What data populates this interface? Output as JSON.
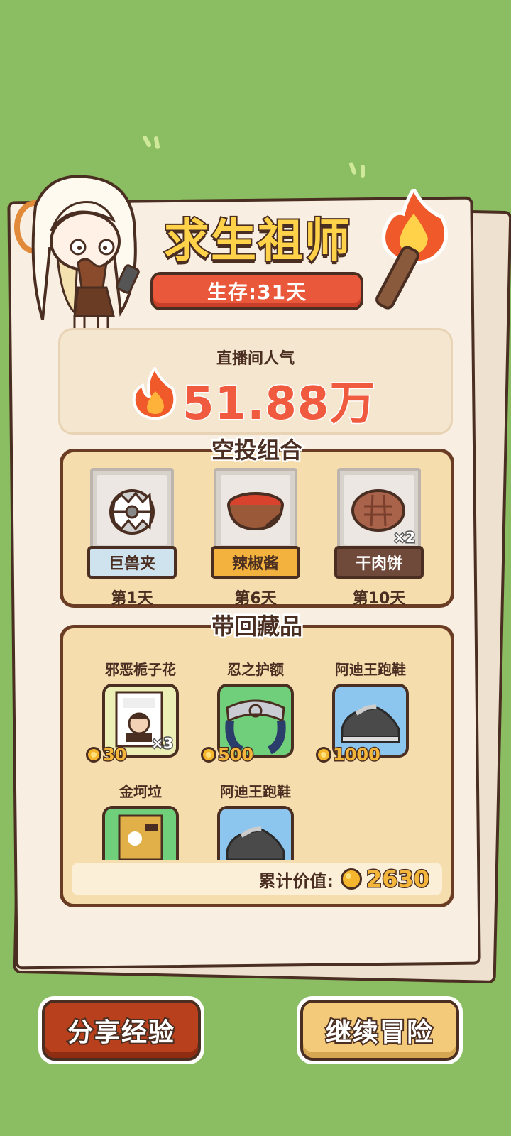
{
  "header": {
    "title": "求生祖师",
    "survival": "生存:31天"
  },
  "popularity": {
    "label": "直播间人气",
    "value": "51.88万"
  },
  "airdrop": {
    "title": "空投组合",
    "items": [
      {
        "name": "巨兽夹",
        "day": "第1天",
        "tag_color": "#cfe3ef",
        "text_color": "#4a2e21"
      },
      {
        "name": "辣椒酱",
        "day": "第6天",
        "tag_color": "#f2b23d",
        "text_color": "#4a2e21"
      },
      {
        "name": "干肉饼",
        "day": "第10天",
        "tag_color": "#6f4a3b",
        "text_color": "#ffffff",
        "qty": "×2"
      }
    ]
  },
  "collection": {
    "title": "带回藏品",
    "items": [
      {
        "name": "邪恶栀子花",
        "price": "30",
        "qty": "×3",
        "card_color": "#ecf0b6",
        "icon": "book-icon"
      },
      {
        "name": "忍之护额",
        "price": "500",
        "card_color": "#6fcf7a",
        "icon": "headband-icon"
      },
      {
        "name": "阿迪王跑鞋",
        "price": "1000",
        "card_color": "#8cc6ef",
        "icon": "sneaker-icon"
      },
      {
        "name": "金坷垃",
        "card_color": "#6fcf7a",
        "icon": "fertilizer-bag-icon"
      },
      {
        "name": "阿迪王跑鞋",
        "card_color": "#8cc6ef",
        "icon": "sneaker-icon"
      }
    ],
    "total_label": "累计价值:",
    "total_value": "2630"
  },
  "buttons": {
    "share": "分享经验",
    "continue": "继续冒险"
  }
}
